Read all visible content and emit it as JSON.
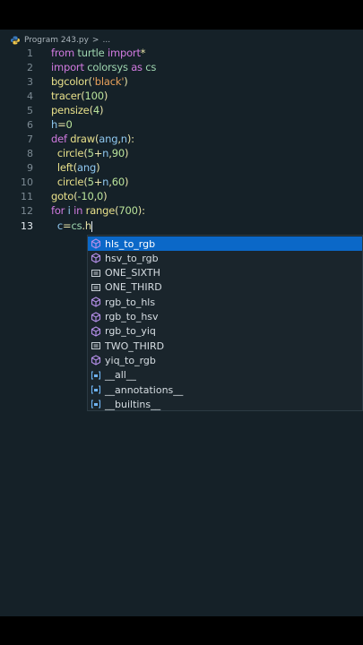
{
  "breadcrumb": {
    "file": "Program 243.py",
    "sep": ">",
    "tail": "..."
  },
  "editor": {
    "current_line": 13,
    "lines": [
      {
        "num": "1"
      },
      {
        "num": "2"
      },
      {
        "num": "3"
      },
      {
        "num": "4"
      },
      {
        "num": "5"
      },
      {
        "num": "6"
      },
      {
        "num": "7"
      },
      {
        "num": "8"
      },
      {
        "num": "9"
      },
      {
        "num": "10"
      },
      {
        "num": "11"
      },
      {
        "num": "12"
      },
      {
        "num": "13"
      }
    ],
    "tokens": {
      "l1": [
        "from",
        " turtle ",
        "import",
        "*"
      ],
      "l2": [
        "import",
        " colorsys ",
        "as",
        " cs"
      ],
      "l3": [
        "bgcolor",
        "(",
        "'black'",
        ")"
      ],
      "l4": [
        "tracer",
        "(",
        "100",
        ")"
      ],
      "l5": [
        "pensize",
        "(",
        "4",
        ")"
      ],
      "l6": [
        "h",
        "=",
        "0"
      ],
      "l7": [
        "def",
        " draw",
        "(",
        "ang",
        ",",
        "n",
        "):"
      ],
      "l8": [
        "  circle",
        "(",
        "5",
        "+",
        "n",
        ",",
        "90",
        ")"
      ],
      "l9": [
        "  left",
        "(",
        "ang",
        ")"
      ],
      "l10": [
        "  circle",
        "(",
        "5",
        "+",
        "n",
        ",",
        "60",
        ")"
      ],
      "l11": [
        "goto",
        "(",
        "-10",
        ",",
        "0",
        ")"
      ],
      "l12": [
        "for",
        " i ",
        "in",
        " range",
        "(",
        "700",
        "):"
      ],
      "l13": [
        "  c",
        "=",
        "cs",
        ".",
        "h"
      ]
    }
  },
  "suggestions": {
    "typed": "h",
    "items": [
      {
        "label": "hls_to_rgb",
        "kind": "method",
        "selected": true
      },
      {
        "label": "hsv_to_rgb",
        "kind": "method"
      },
      {
        "label": "ONE_SIXTH",
        "kind": "constant"
      },
      {
        "label": "ONE_THIRD",
        "kind": "constant"
      },
      {
        "label": "rgb_to_hls",
        "kind": "method"
      },
      {
        "label": "rgb_to_hsv",
        "kind": "method"
      },
      {
        "label": "rgb_to_yiq",
        "kind": "method"
      },
      {
        "label": "TWO_THIRD",
        "kind": "constant"
      },
      {
        "label": "yiq_to_rgb",
        "kind": "method"
      },
      {
        "label": "__all__",
        "kind": "variable"
      },
      {
        "label": "__annotations__",
        "kind": "variable"
      },
      {
        "label": "__builtins__",
        "kind": "variable"
      }
    ]
  },
  "colors": {
    "editor_bg": "#152128",
    "selection": "#0b68c8",
    "keyword": "#d17ae0"
  }
}
